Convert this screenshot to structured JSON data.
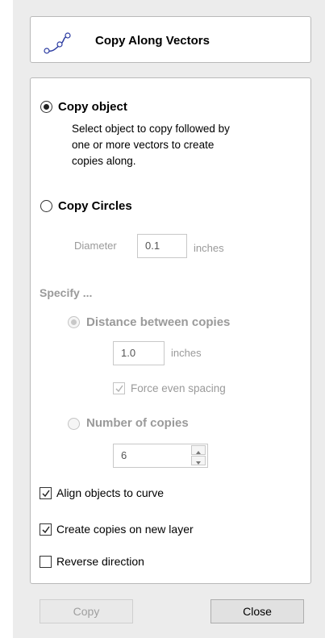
{
  "header": {
    "title": "Copy Along Vectors",
    "icon": "curve-with-nodes-icon"
  },
  "mode": {
    "copy_object_label": "Copy object",
    "copy_object_description": [
      "Select object to copy followed by",
      "one or more vectors to create",
      "copies along."
    ],
    "copy_circles_label": "Copy Circles",
    "selected": "Copy object"
  },
  "diameter": {
    "label": "Diameter",
    "value": "0.1",
    "units": "inches"
  },
  "specify": {
    "heading": "Specify ...",
    "distance_label": "Distance between copies",
    "distance_value": "1.0",
    "distance_units": "inches",
    "force_even_label": "Force even spacing",
    "number_label": "Number of copies",
    "number_value": "6"
  },
  "options": {
    "align_label": "Align objects to curve",
    "align_checked": true,
    "new_layer_label": "Create copies on new layer",
    "new_layer_checked": true,
    "reverse_label": "Reverse direction",
    "reverse_checked": false
  },
  "buttons": {
    "copy_label": "Copy",
    "close_label": "Close"
  }
}
